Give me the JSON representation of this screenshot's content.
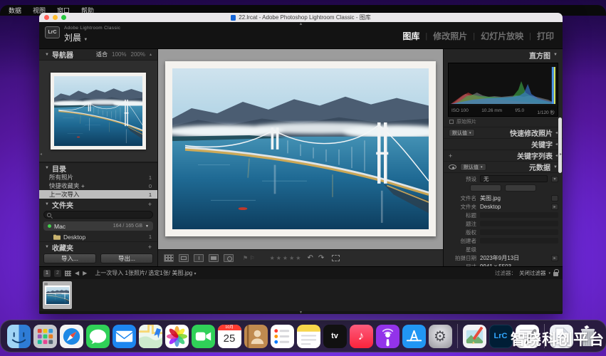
{
  "menu_bar": {
    "items": [
      "数据",
      "视图",
      "窗口",
      "帮助"
    ]
  },
  "window_title": "22.lrcat - Adobe Photoshop Lightroom Classic - 图库",
  "identity": {
    "logo": "LrC",
    "app": "Adobe Lightroom Classic",
    "user": "刘晨"
  },
  "modules": {
    "items": [
      {
        "label": "图库"
      },
      {
        "label": "修改照片"
      },
      {
        "label": "幻灯片放映"
      },
      {
        "label": "打印"
      }
    ]
  },
  "left_panel": {
    "navigator_title": "导航器",
    "zoom_fit": "适合",
    "zoom_100": "100%",
    "zoom_200": "200%",
    "catalog_title": "目录",
    "catalog_items": [
      {
        "label": "所有照片",
        "count": "1"
      },
      {
        "label": "快捷收藏夹 +",
        "count": "0"
      },
      {
        "label": "上一次导入",
        "count": "1"
      }
    ],
    "folders_title": "文件夹",
    "volume_name": "Mac",
    "volume_capacity": "164 / 165 GB",
    "folder_items": [
      {
        "label": "Desktop",
        "count": "1"
      }
    ],
    "collections_title": "收藏夹",
    "import_button": "导入...",
    "export_button": "导出..."
  },
  "right_panel": {
    "histogram_title": "直方图",
    "histogram_stats": {
      "iso": "ISO 100",
      "focal": "10.26 mm",
      "aperture": "f/5.0",
      "shutter": "1/120 秒"
    },
    "original_photo_label": "原始照片",
    "quick_develop_title": "快速修改照片",
    "quick_develop_preset": "默认值",
    "keywording_title": "关键字",
    "keyword_list_title": "关键字列表",
    "metadata_title": "元数据",
    "metadata_preset": "默认值",
    "preset_label": "预设",
    "preset_value": "无",
    "fields": [
      {
        "label": "文件名",
        "value": "美图.jpg"
      },
      {
        "label": "文件夹",
        "value": "Desktop"
      },
      {
        "label": "标题",
        "value": ""
      },
      {
        "label": "题注",
        "value": ""
      },
      {
        "label": "版权",
        "value": ""
      },
      {
        "label": "创建者",
        "value": ""
      },
      {
        "label": "星级",
        "value": ""
      },
      {
        "label": "拍摄日期",
        "value": "2023年9月13日"
      },
      {
        "label": "尺寸",
        "value": "9941 x 5503"
      }
    ]
  },
  "filmstrip": {
    "monitor_primary": "1",
    "monitor_secondary": "2",
    "status": "上一次导入 1张照片/ 选定1张/ 美图.jpg",
    "filter_label": "过滤器：",
    "filter_value": "关闭过滤器"
  },
  "dock": {
    "calendar_month": "10月",
    "calendar_day": "25",
    "tv_label": "tv",
    "lrc_label": "LrC"
  },
  "watermark": "智晓科创平台"
}
